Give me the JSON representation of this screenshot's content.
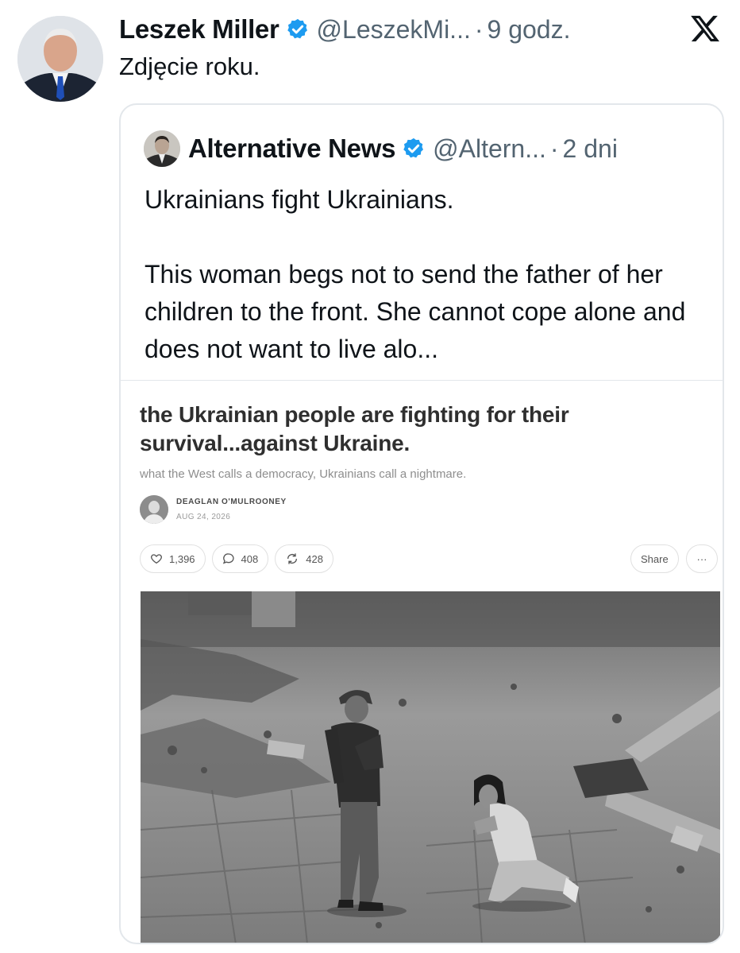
{
  "tweet": {
    "author_name": "Leszek Miller",
    "handle": "@LeszekMi...",
    "separator": "·",
    "time": "9 godz.",
    "text": "Zdjęcie roku."
  },
  "quoted_tweet": {
    "author_name": "Alternative News",
    "handle": "@Altern...",
    "separator": "·",
    "time": "2 dni",
    "text": "Ukrainians fight Ukrainians.\n\nThis woman begs not to send the father of her children to the front. She cannot cope alone and does not want to live alo..."
  },
  "article": {
    "title": "the Ukrainian people are fighting for their survival...against Ukraine.",
    "subtitle": "what the West calls a democracy, Ukrainians call a nightmare.",
    "author": "DEAGLAN O'MULROONEY",
    "date": "AUG 24, 2026",
    "likes": "1,396",
    "comments": "408",
    "restacks": "428",
    "share_label": "Share",
    "more_label": "···"
  },
  "colors": {
    "text": "#0f1419",
    "muted": "#536471",
    "verified": "#1d9bf0",
    "border": "#e3e7eb"
  },
  "icons": [
    "verified-badge-icon",
    "x-logo-icon",
    "heart-icon",
    "comment-icon",
    "restack-icon"
  ]
}
